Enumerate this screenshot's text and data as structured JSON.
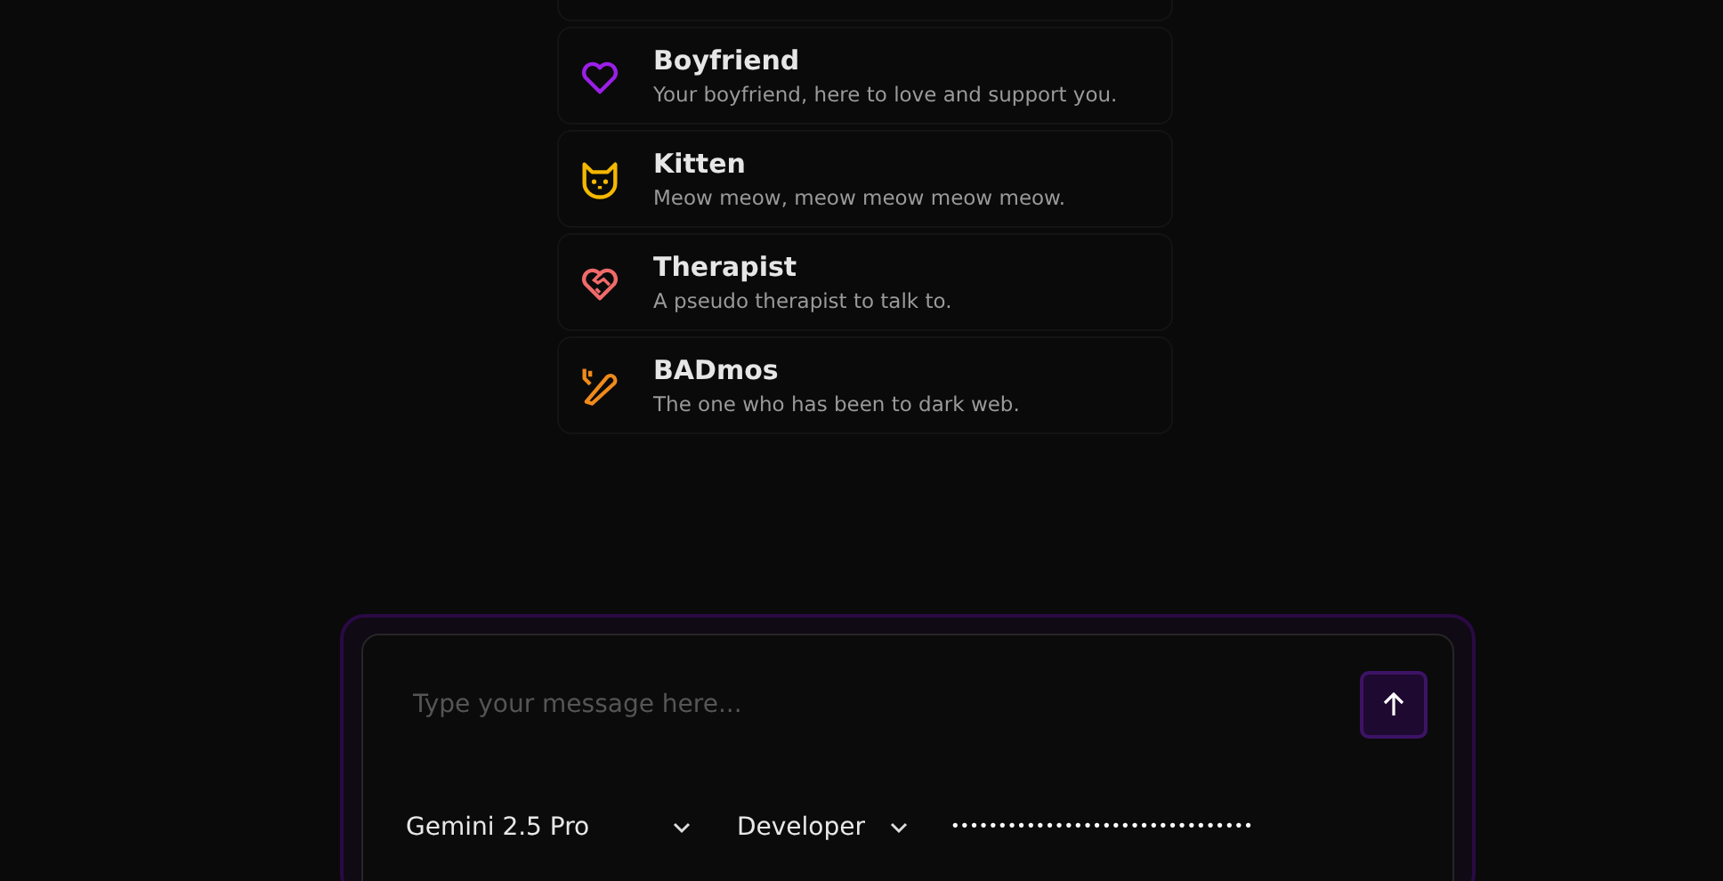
{
  "personas": [
    {
      "kind": "heart",
      "color": "#9b1fe8",
      "title": "Boyfriend",
      "description": "Your boyfriend, here to love and support you."
    },
    {
      "kind": "cat",
      "color": "#f5b800",
      "title": "Kitten",
      "description": "Meow meow, meow meow meow meow."
    },
    {
      "kind": "handheart",
      "color": "#f06a6a",
      "title": "Therapist",
      "description": "A pseudo therapist to talk to."
    },
    {
      "kind": "knife",
      "color": "#f08a1a",
      "title": "BADmos",
      "description": "The one who has been to dark web."
    }
  ],
  "composer": {
    "placeholder": "Type your message here...",
    "model_select": "Gemini 2.5 Pro",
    "mode_select": "Developer",
    "api_key": "••••••••••••••••••••••••••••••••"
  }
}
